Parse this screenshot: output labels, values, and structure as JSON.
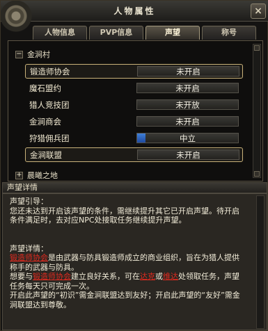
{
  "window": {
    "title": "人物属性",
    "close_glyph": "×"
  },
  "tabs": [
    {
      "label": "人物信息"
    },
    {
      "label": "PVP信息"
    },
    {
      "label": "声望"
    },
    {
      "label": "称号"
    }
  ],
  "group": {
    "toggle": "−",
    "label": "金涧村"
  },
  "next_group": {
    "toggle": "+",
    "label": "晨曦之地"
  },
  "factions": [
    {
      "name": "锻造师协会",
      "status": "未开启",
      "progress": 0
    },
    {
      "name": "魔石盟约",
      "status": "未开启",
      "progress": 0
    },
    {
      "name": "猎人竞技团",
      "status": "未开放",
      "progress": 0
    },
    {
      "name": "金涧商会",
      "status": "未开启",
      "progress": 0
    },
    {
      "name": "狩猎佣兵团",
      "status": "中立",
      "progress": 0.08
    },
    {
      "name": "金涧联盟",
      "status": "未开启",
      "progress": 0
    }
  ],
  "details": {
    "header": "声望详情",
    "guide_title": "声望引导：",
    "guide_text": "您还未达到开启该声望的条件，需继续提升其它已开启声望。待开启条件满足时，去对应NPC处接取任务继续提升声望。",
    "detail_title": "声望详情：",
    "faction_link": "锻造师协会",
    "desc1": "是由武器与防具锻造师成立的商业组织，旨在为猎人提供称手的武器与防具。",
    "want_prefix": "想要与",
    "want_mid": "建立良好关系，可在",
    "npc1": "达克",
    "or": "或",
    "npc2": "维达",
    "want_suffix": "处领取任务，声望任务每天只可完成一次。",
    "unlock1": "开启此声望的“初识”需金涧联盟达到友好；开启此声望的“友好”需金涧联盟达到尊敬。"
  }
}
